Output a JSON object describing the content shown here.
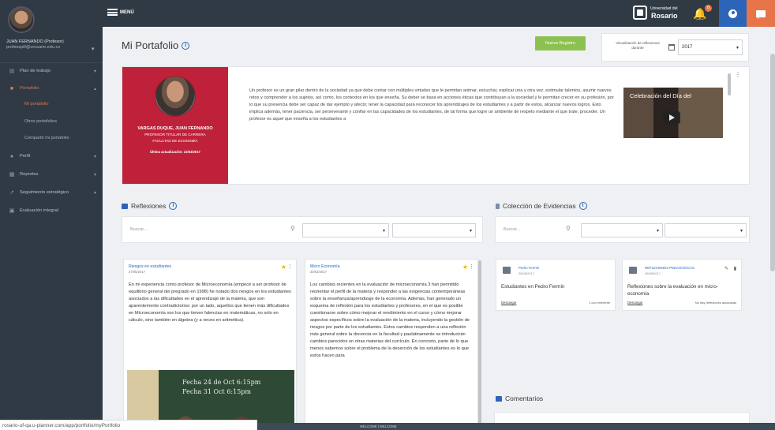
{
  "sidebar": {
    "user_name": "JUAN FERNANDO (Profesor)",
    "user_email": "professpill@urosario.edu.co",
    "items": [
      {
        "label": "Plan de trabajo",
        "icon": "clipboard-icon"
      },
      {
        "label": "Portafolio",
        "icon": "briefcase-icon"
      },
      {
        "label": "Perfil",
        "icon": "user-icon"
      },
      {
        "label": "Reportes",
        "icon": "report-icon"
      },
      {
        "label": "Seguimiento estratégico",
        "icon": "trend-icon"
      },
      {
        "label": "Evaluación integral",
        "icon": "evaluation-icon"
      }
    ],
    "sub_items": [
      {
        "label": "Mi portafolio"
      },
      {
        "label": "Otros portafolios"
      },
      {
        "label": "Compartir mi portafolio"
      }
    ]
  },
  "topbar": {
    "menu_label": "MENÚ",
    "logo_small": "Universidad del",
    "logo_big": "Rosario",
    "notification_count": "0"
  },
  "page": {
    "title": "Mi Portafolio",
    "new_button": "Nueva Registro",
    "period_label": "Visualización de reflexiones durante",
    "period_value": "2017"
  },
  "profile": {
    "name": "VARGAS DUQUE, JUAN FERNANDO",
    "role_1": "PROFESOR TITULAR DE CARRERA",
    "role_2": "FACULTAD DE ECONOMÍA",
    "updated": "Última actualización: 22/03/2017",
    "bio": "Un profesor es un gran pilar dentro de la sociedad ya que debe contar con múltiples virtudes que le permitan animar, escuchar, explicar una y otra vez, estimular talentos, asumir nuevos retos y comprender a los sujetos, así como, los contextos en los que enseña. Su deber se basa en acciones éticas que contribuyan a la sociedad y le permitan crecer en su profesión, por lo que su presencia debe ser capaz de dar ejemplo y afecto; tener la capacidad para reconocer los aprendizajes de los estudiantes y a partir de estos, alcanzar nuevos logros. Esto implica además, tener paciencia, ser perseverante y confiar en las capacidades de los estudiantes, de tal forma que logre un ambiente de respeto mediante el que trate, proceder. Un profesor es aquel que enseña a los estudiantes a",
    "video_title": "Celebración del Día del"
  },
  "reflexiones": {
    "title": "Reflexiones",
    "search_placeholder": "Buscar...",
    "cards": [
      {
        "title": "Riesgos en estudiantes",
        "date": "27/05/2017",
        "body": "En mi experiencia como profesor de Microeconomía (empecé a ser profesor de equilibrio general del pregrado en 1998) he notado dos riesgos en los estudiantes asociados a las dificultades en el aprendizaje de la materia, que son aparentemente contradictorios: por un lado, aquellos que tienen más dificultades en Microeconomía son los que tienen falencias en matemáticas, no solo en cálculo, sino también en álgebra (y a veces en aritmética).",
        "board_line_1": "Fecha 24 de Oct 6:15pm",
        "board_line_2": "Fecha 31 Oct 6:15pm"
      },
      {
        "title": "Micro Economía",
        "date": "20/03/2017",
        "body": "Los cambios recientes en la evaluación de microeconomía 3 han permitido reorientar el perfil de la materia y responder a las exigencias contemporáneas sobre la enseñanza/aprendizaje de la economía. Además, han generado un esquema de reflexión para los estudiantes y profesores, en el que es posible cuestionarse sobre cómo mejorar el rendimiento en el curso y cómo mejorar aspectos específicos sobre la evaluación de la materia, incluyendo la gestión de riesgos por parte de los estudiantes. Estos cambios responden a una reflexión más general sobre la docencia en la facultad y paulatinamente se introducirán cambios parecidos en otras materias del currículo. En concreto, parte de lo que menos sabemos sobre el problema de la deserción de los estudiantes es lo que estos hacen para"
      }
    ]
  },
  "evidencias": {
    "title": "Colección de Evidencias",
    "search_placeholder": "Buscar...",
    "cards": [
      {
        "type": "Pedro Fermín",
        "date": "26/08/2017",
        "name": "Estudiantes en Pedro Fermín",
        "link": "Descargar",
        "count": "1 con referente"
      },
      {
        "type": "REFLEXIONES PEDAGÓGICAS",
        "date": "26/08/2017",
        "name": "Reflexiones sobre la evaluación en micro-economía",
        "link": "Descargar",
        "count": "No hay reflexiones asociadas"
      }
    ]
  },
  "comentarios": {
    "title": "Comentarios"
  },
  "status_url": "rosario-uf-qa.u-planner.com/app/portfolio/myPortfolio",
  "footer_text": "WELCOME | WELCOME",
  "colors": {
    "sidebar": "#2f3a45",
    "accent_orange": "#e8754a",
    "accent_blue": "#2c64b8",
    "profile_red": "#c0213a",
    "button_green": "#8cc152"
  }
}
